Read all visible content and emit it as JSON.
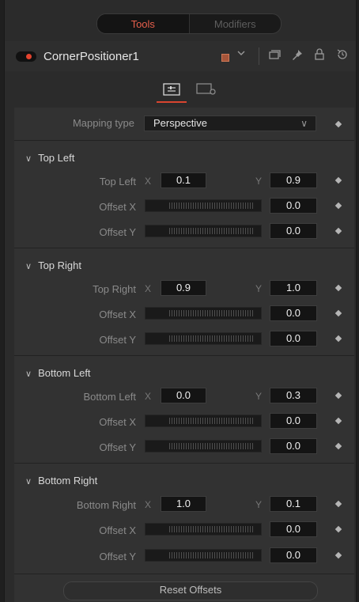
{
  "tabs": {
    "tools": "Tools",
    "modifiers": "Modifiers"
  },
  "header": {
    "tool_name": "CornerPositioner1",
    "swatch_color": "#a6553a"
  },
  "mapping": {
    "label": "Mapping type",
    "value": "Perspective"
  },
  "sections": {
    "top_left": {
      "title": "Top Left",
      "point_label": "Top Left",
      "x_axis": "X",
      "y_axis": "Y",
      "x": "0.1",
      "y": "0.9",
      "offset_x_label": "Offset X",
      "offset_y_label": "Offset Y",
      "offset_x": "0.0",
      "offset_y": "0.0"
    },
    "top_right": {
      "title": "Top Right",
      "point_label": "Top Right",
      "x_axis": "X",
      "y_axis": "Y",
      "x": "0.9",
      "y": "1.0",
      "offset_x_label": "Offset X",
      "offset_y_label": "Offset Y",
      "offset_x": "0.0",
      "offset_y": "0.0"
    },
    "bottom_left": {
      "title": "Bottom Left",
      "point_label": "Bottom Left",
      "x_axis": "X",
      "y_axis": "Y",
      "x": "0.0",
      "y": "0.3",
      "offset_x_label": "Offset X",
      "offset_y_label": "Offset Y",
      "offset_x": "0.0",
      "offset_y": "0.0"
    },
    "bottom_right": {
      "title": "Bottom Right",
      "point_label": "Bottom Right",
      "x_axis": "X",
      "y_axis": "Y",
      "x": "1.0",
      "y": "0.1",
      "offset_x_label": "Offset X",
      "offset_y_label": "Offset Y",
      "offset_x": "0.0",
      "offset_y": "0.0"
    }
  },
  "reset_button": "Reset Offsets"
}
